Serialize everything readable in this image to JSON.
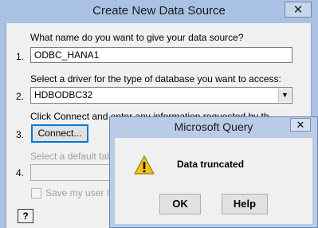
{
  "main_window": {
    "title": "Create New Data Source",
    "close_glyph": "✕"
  },
  "form": {
    "step1": {
      "number": "1.",
      "prompt": "What name do you want to give your data source?",
      "value": "ODBC_HANA1"
    },
    "step2": {
      "number": "2.",
      "prompt": "Select a driver for the type of database you want to access:",
      "value": "HDBODBC32"
    },
    "step3": {
      "number": "3.",
      "prompt": "Click Connect and enter any information requested by the driver:",
      "connect_label": "Connect..."
    },
    "step4": {
      "number": "4.",
      "prompt": "Select a default table for the data source (optional):",
      "value": ""
    },
    "save_user_id_label": "Save my user ID and password in the data source definition",
    "save_user_id_checked": false,
    "help_label": "?"
  },
  "dialog": {
    "title": "Microsoft Query",
    "close_glyph": "✕",
    "message": "Data truncated",
    "icon": "warning-icon",
    "ok_label": "OK",
    "help_label": "Help"
  },
  "colors": {
    "title_bar": "#a9c1e3",
    "focus_blue": "#0078d7",
    "warning_yellow": "#f2c21b"
  }
}
